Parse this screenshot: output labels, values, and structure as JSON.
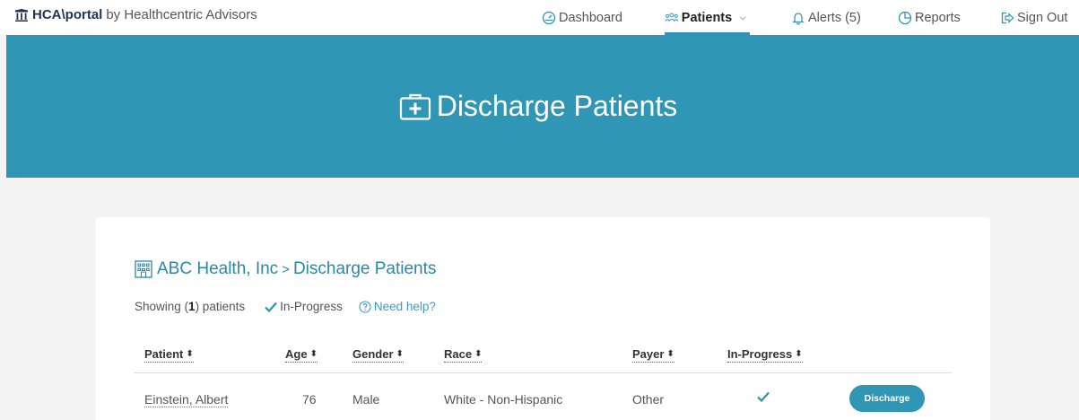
{
  "brand": {
    "name": "HCA\\portal",
    "by": "by Healthcentric Advisors"
  },
  "nav": {
    "dashboard": "Dashboard",
    "patients": "Patients",
    "alerts": "Alerts (5)",
    "reports": "Reports",
    "signout": "Sign Out",
    "active": "patients"
  },
  "hero": {
    "title": "Discharge Patients"
  },
  "breadcrumb": {
    "org": "ABC Health, Inc",
    "separator": ">",
    "page": "Discharge Patients"
  },
  "meta": {
    "showing_prefix": "Showing (",
    "count": "1",
    "showing_suffix": ") patients",
    "in_progress": "In-Progress",
    "help": "Need help?"
  },
  "table": {
    "columns": {
      "patient": "Patient",
      "age": "Age",
      "gender": "Gender",
      "race": "Race",
      "payer": "Payer",
      "in_progress": "In-Progress"
    },
    "sort_icon": "⬍",
    "rows": [
      {
        "patient": "Einstein, Albert",
        "age": "76",
        "gender": "Male",
        "race": "White - Non-Hispanic",
        "payer": "Other",
        "in_progress": true,
        "action": "Discharge"
      }
    ]
  },
  "colors": {
    "accent": "#2f97b5",
    "link": "#2c86a8",
    "brand": "#1d3557"
  }
}
